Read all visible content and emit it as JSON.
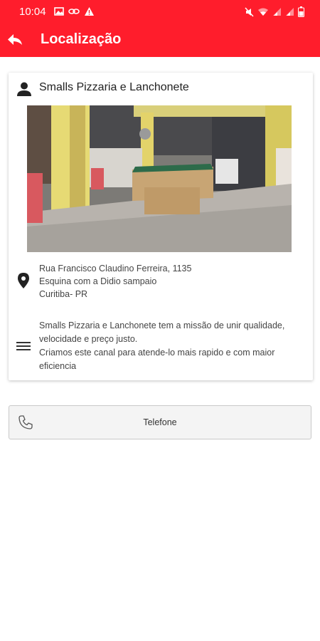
{
  "status_bar": {
    "time": "10:04",
    "left_icons": [
      "image-icon",
      "link-icon",
      "warning-icon"
    ],
    "right_icons": [
      "mute-icon",
      "wifi-icon",
      "signal-icon",
      "signal-icon",
      "battery-icon"
    ]
  },
  "app_bar": {
    "title": "Localização",
    "back_icon": "back-arrow-icon",
    "color": "#ff1d2c"
  },
  "card": {
    "header_icon": "person-icon",
    "title": "Smalls Pizzaria e Lanchonete",
    "photo_icon": "photo-of-restaurant-interior",
    "address_icon": "location-pin-icon",
    "address_lines": [
      "Rua Francisco Claudino Ferreira, 1135",
      "Esquina com a Didio sampaio",
      "Curitiba- PR"
    ],
    "description_icon": "menu-lines-icon",
    "description_lines": [
      "Smalls Pizzaria e Lanchonete tem a missão de unir qualidade,",
      "velocidade e preço justo.",
      "Criamos este canal para atende-lo mais rapido e com maior",
      "eficiencia"
    ]
  },
  "phone_button": {
    "icon": "phone-icon",
    "label": "Telefone"
  }
}
